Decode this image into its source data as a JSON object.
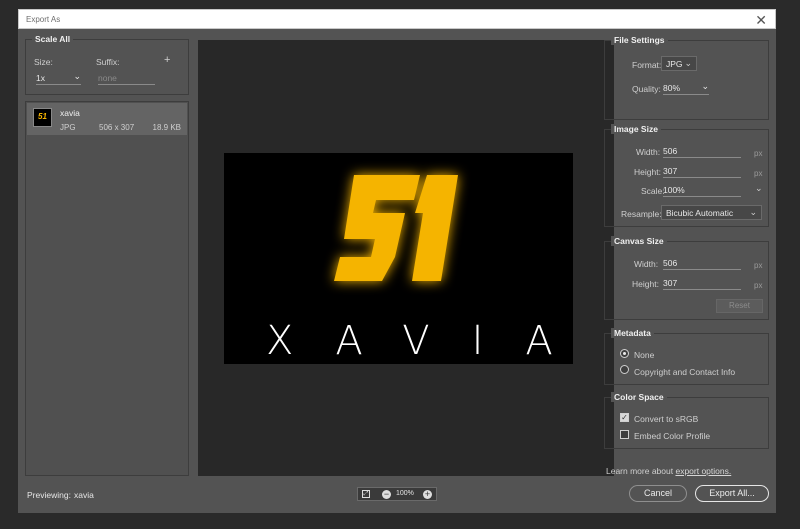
{
  "window": {
    "title": "Export As",
    "close_glyph": "✕"
  },
  "scale_all": {
    "title": "Scale All",
    "size_label": "Size:",
    "suffix_label": "Suffix:",
    "add_glyph": "+",
    "size_value": "1x",
    "suffix_placeholder": "none"
  },
  "asset": {
    "name": "xavia",
    "format": "JPG",
    "dimensions": "506 x 307",
    "filesize": "18.9 KB",
    "thumb_text": "51"
  },
  "preview": {
    "logo_number": "51",
    "logo_word": "XAVIA",
    "status_label": "Previewing:",
    "status_value": "xavia",
    "zoom": "100%"
  },
  "file_settings": {
    "title": "File Settings",
    "format_label": "Format:",
    "format_value": "JPG",
    "quality_label": "Quality:",
    "quality_value": "80%"
  },
  "image_size": {
    "title": "Image Size",
    "width_label": "Width:",
    "width_value": "506",
    "height_label": "Height:",
    "height_value": "307",
    "scale_label": "Scale:",
    "scale_value": "100%",
    "resample_label": "Resample:",
    "resample_value": "Bicubic Automatic",
    "unit": "px"
  },
  "canvas_size": {
    "title": "Canvas Size",
    "width_label": "Width:",
    "width_value": "506",
    "height_label": "Height:",
    "height_value": "307",
    "unit": "px",
    "reset_label": "Reset"
  },
  "metadata": {
    "title": "Metadata",
    "options": [
      "None",
      "Copyright and Contact Info"
    ],
    "selected": "None"
  },
  "color_space": {
    "title": "Color Space",
    "convert_label": "Convert to sRGB",
    "convert_checked": true,
    "embed_label": "Embed Color Profile",
    "embed_checked": false
  },
  "footer": {
    "learn_prefix": "Learn more about ",
    "learn_link": "export options.",
    "cancel_label": "Cancel",
    "export_label": "Export All..."
  },
  "colors": {
    "logo_yellow": "#f5b400",
    "dialog_bg": "#535353",
    "preview_bg": "#282828"
  }
}
